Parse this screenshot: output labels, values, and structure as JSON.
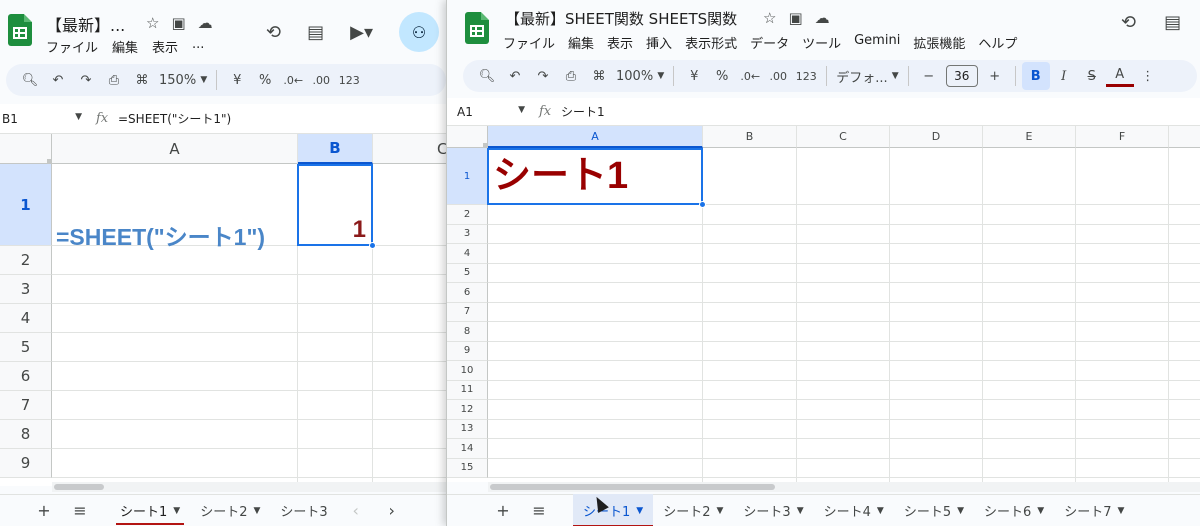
{
  "left": {
    "title": "【最新】...",
    "menus": [
      "ファイル",
      "編集",
      "表示",
      "..."
    ],
    "toolbar": {
      "zoom": "150%",
      "yen": "¥",
      "percent": "%",
      "dec_minus": ".0←",
      "dec_plus": ".00",
      "format_123": "123"
    },
    "namebox": "B1",
    "formula": "=SHEET(\"シート1\")",
    "columns": [
      "A",
      "B",
      "C"
    ],
    "rows": [
      "1",
      "2",
      "3",
      "4",
      "5",
      "6",
      "7",
      "8",
      "9"
    ],
    "cell_a1_text": "=SHEET(\"シート1\")",
    "cell_b1_value": "1",
    "tabs": [
      "シート1",
      "シート2",
      "シート3"
    ],
    "colors": {
      "formula_text": "#4a86c8",
      "result_text": "#8b1a1a"
    }
  },
  "right": {
    "title": "【最新】SHEET関数 SHEETS関数",
    "menus": [
      "ファイル",
      "編集",
      "表示",
      "挿入",
      "表示形式",
      "データ",
      "ツール",
      "Gemini",
      "拡張機能",
      "ヘルプ"
    ],
    "toolbar": {
      "zoom": "100%",
      "yen": "¥",
      "percent": "%",
      "dec_minus": ".0←",
      "dec_plus": ".00",
      "format_123": "123",
      "font": "デフォ...",
      "font_size": "36",
      "minus": "−",
      "plus": "+",
      "bold": "B",
      "italic": "I",
      "strike": "S",
      "text_color": "A"
    },
    "namebox": "A1",
    "formula": "シート1",
    "columns": [
      "A",
      "B",
      "C",
      "D",
      "E",
      "F"
    ],
    "rows": [
      "1",
      "2",
      "3",
      "4",
      "5",
      "6",
      "7",
      "8",
      "9",
      "10",
      "11",
      "12",
      "13",
      "14",
      "15"
    ],
    "cell_a1_text": "シート1",
    "tabs": [
      "シート1",
      "シート2",
      "シート3",
      "シート4",
      "シート5",
      "シート6",
      "シート7"
    ],
    "colors": {
      "cell_text": "#990000",
      "accent": "#1a73e8"
    }
  }
}
